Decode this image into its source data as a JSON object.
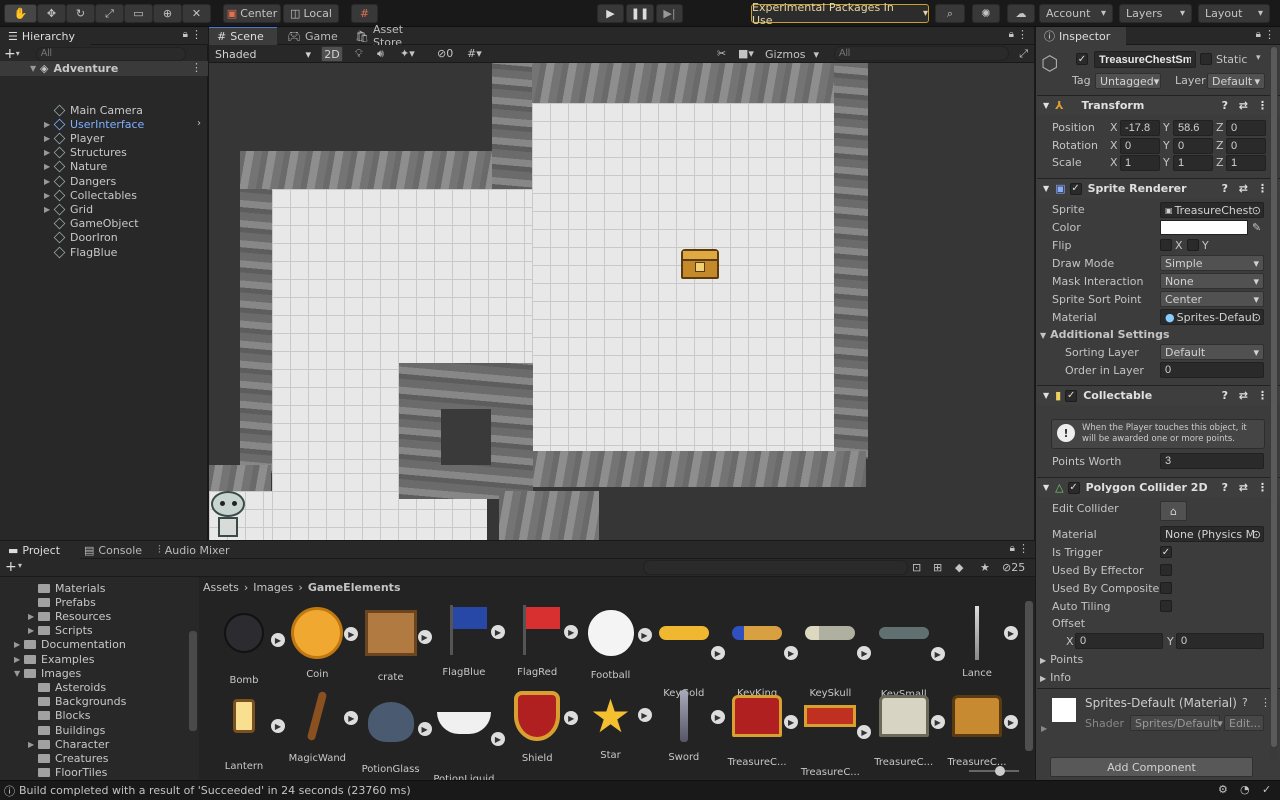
{
  "toolbar": {
    "center": "Center",
    "local": "Local",
    "experimental": "Experimental Packages In Use",
    "account": "Account",
    "layers": "Layers",
    "layout": "Layout"
  },
  "hierarchy": {
    "tab": "Hierarchy",
    "search_placeholder": "All",
    "root": "Adventure",
    "items": [
      "Main Camera",
      "UserInterface",
      "Player",
      "Structures",
      "Nature",
      "Dangers",
      "Collectables",
      "Grid",
      "GameObject",
      "DoorIron",
      "FlagBlue"
    ]
  },
  "scene": {
    "tabs": [
      "Scene",
      "Game",
      "Asset Store"
    ],
    "shading": "Shaded",
    "mode2d": "2D",
    "hidden_count": "0",
    "gizmos": "Gizmos",
    "search_placeholder": "All"
  },
  "inspector": {
    "tab": "Inspector",
    "object_name": "TreasureChestSma",
    "static": "Static",
    "tag_label": "Tag",
    "tag": "Untagged",
    "layer_label": "Layer",
    "layer": "Default",
    "transform": {
      "title": "Transform",
      "position_label": "Position",
      "position": [
        "-17.8",
        "58.6",
        "0"
      ],
      "rotation_label": "Rotation",
      "rotation": [
        "0",
        "0",
        "0"
      ],
      "scale_label": "Scale",
      "scale": [
        "1",
        "1",
        "1"
      ]
    },
    "sprite_renderer": {
      "title": "Sprite Renderer",
      "sprite_label": "Sprite",
      "sprite": "TreasureChest",
      "color_label": "Color",
      "color": "#ffffff",
      "flip_label": "Flip",
      "flip_x": "X",
      "flip_y": "Y",
      "draw_mode_label": "Draw Mode",
      "draw_mode": "Simple",
      "mask_label": "Mask Interaction",
      "mask": "None",
      "sort_point_label": "Sprite Sort Point",
      "sort_point": "Center",
      "material_label": "Material",
      "material": "Sprites-Defaul",
      "additional": "Additional Settings",
      "sorting_layer_label": "Sorting Layer",
      "sorting_layer": "Default",
      "order_label": "Order in Layer",
      "order": "0"
    },
    "collectable": {
      "title": "Collectable",
      "help": "When the Player touches this object, it will be awarded one or more points.",
      "points_label": "Points Worth",
      "points": "3"
    },
    "collider": {
      "title": "Polygon Collider 2D",
      "edit_label": "Edit Collider",
      "material_label": "Material",
      "material": "None (Physics M",
      "trigger_label": "Is Trigger",
      "effector_label": "Used By Effector",
      "composite_label": "Used By Composite",
      "tiling_label": "Auto Tiling",
      "offset_label": "Offset",
      "offset_x": "0",
      "offset_y": "0",
      "points_label": "Points",
      "info_label": "Info"
    },
    "material_preview": {
      "name": "Sprites-Default (Material)",
      "shader_label": "Shader",
      "shader": "Sprites/Default",
      "edit": "Edit..."
    },
    "add_component": "Add Component"
  },
  "project": {
    "tabs": [
      "Project",
      "Console",
      "Audio Mixer"
    ],
    "hidden_count": "25",
    "tree": [
      {
        "label": "Materials",
        "indent": 2,
        "arrow": ""
      },
      {
        "label": "Prefabs",
        "indent": 2,
        "arrow": ""
      },
      {
        "label": "Resources",
        "indent": 2,
        "arrow": "▶"
      },
      {
        "label": "Scripts",
        "indent": 2,
        "arrow": "▶"
      },
      {
        "label": "Documentation",
        "indent": 1,
        "arrow": "▶"
      },
      {
        "label": "Examples",
        "indent": 1,
        "arrow": "▶"
      },
      {
        "label": "Images",
        "indent": 1,
        "arrow": "▼"
      },
      {
        "label": "Asteroids",
        "indent": 2,
        "arrow": ""
      },
      {
        "label": "Backgrounds",
        "indent": 2,
        "arrow": ""
      },
      {
        "label": "Blocks",
        "indent": 2,
        "arrow": ""
      },
      {
        "label": "Buildings",
        "indent": 2,
        "arrow": ""
      },
      {
        "label": "Character",
        "indent": 2,
        "arrow": "▶"
      },
      {
        "label": "Creatures",
        "indent": 2,
        "arrow": ""
      },
      {
        "label": "FloorTiles",
        "indent": 2,
        "arrow": ""
      }
    ],
    "breadcrumb": [
      "Assets",
      "Images",
      "GameElements"
    ],
    "assets": [
      {
        "label": "Bomb",
        "icon": "bomb-icon"
      },
      {
        "label": "Coin",
        "icon": "coin-icon"
      },
      {
        "label": "crate",
        "icon": "crate-icon"
      },
      {
        "label": "FlagBlue",
        "icon": "flag-blue-icon"
      },
      {
        "label": "FlagRed",
        "icon": "flag-red-icon"
      },
      {
        "label": "Football",
        "icon": "football-icon"
      },
      {
        "label": "KeyGold",
        "icon": "key-gold-icon"
      },
      {
        "label": "KeyKing",
        "icon": "key-king-icon"
      },
      {
        "label": "KeySkull",
        "icon": "key-skull-icon"
      },
      {
        "label": "KeySmall",
        "icon": "key-small-icon"
      },
      {
        "label": "Lance",
        "icon": "lance-icon"
      },
      {
        "label": "Lantern",
        "icon": "lantern-icon"
      },
      {
        "label": "MagicWand",
        "icon": "magic-wand-icon"
      },
      {
        "label": "PotionGlass",
        "icon": "potion-glass-icon"
      },
      {
        "label": "PotionLiquid",
        "icon": "potion-liquid-icon"
      },
      {
        "label": "Shield",
        "icon": "shield-icon"
      },
      {
        "label": "Star",
        "icon": "star-icon"
      },
      {
        "label": "Sword",
        "icon": "sword-icon"
      },
      {
        "label": "TreasureC...",
        "icon": "treasure-chest-icon"
      },
      {
        "label": "TreasureC...",
        "icon": "treasure-chest-red-icon"
      },
      {
        "label": "TreasureC...",
        "icon": "treasure-chest-skull-icon"
      },
      {
        "label": "TreasureC...",
        "icon": "treasure-chest-gold-icon"
      }
    ]
  },
  "status": {
    "message": "Build completed with a result of 'Succeeded' in 24 seconds (23760 ms)"
  }
}
